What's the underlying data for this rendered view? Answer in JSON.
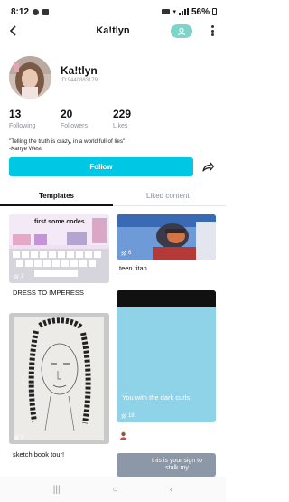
{
  "status": {
    "time": "8:12",
    "battery": "56%"
  },
  "profile": {
    "title": "Ka!tlyn",
    "name": "Ka!tlyn",
    "id_text": "ID:9440883179",
    "stats": [
      {
        "num": "13",
        "label": "Following"
      },
      {
        "num": "20",
        "label": "Followers"
      },
      {
        "num": "229",
        "label": "Likes"
      }
    ],
    "bio_line1": "\"Telling the truth is crazy, in a world full of lies\"",
    "bio_line2": "-Kanye West",
    "follow_label": "Follow"
  },
  "tabs": {
    "templates": "Templates",
    "liked": "Liked content"
  },
  "cards": [
    {
      "caption": "DRESS TO IMPERESS",
      "count": "2",
      "img_text": "first some codes"
    },
    {
      "caption": "teen titan",
      "count": "6",
      "img_text": ""
    },
    {
      "caption": "",
      "count": "18",
      "img_text": "You with the dark curls"
    },
    {
      "caption": "sketch book tour!",
      "count": "3",
      "img_text": ""
    },
    {
      "caption": "",
      "count": "",
      "img_text": "this is your sign to stalk my"
    }
  ],
  "colors": {
    "accent": "#00c8e4",
    "follow_user": "#7fd4c9"
  },
  "icons": {
    "back": "back-arrow-icon",
    "more": "more-vertical-icon",
    "share": "share-icon",
    "count": "template-count-icon"
  }
}
